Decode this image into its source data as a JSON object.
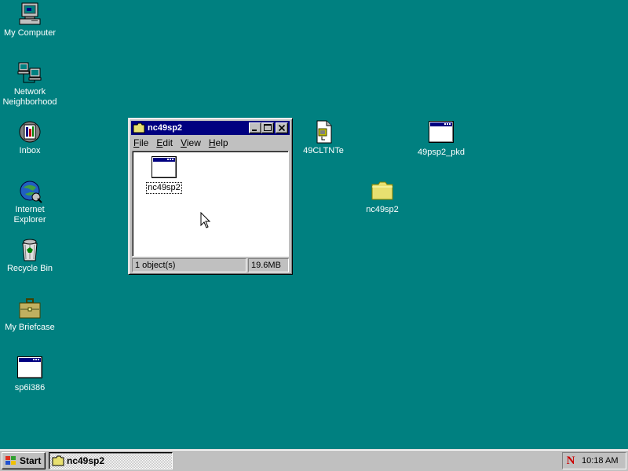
{
  "desktop": {
    "background": "#008080",
    "icons": [
      {
        "label": "My Computer",
        "icon": "my-computer-icon"
      },
      {
        "label": "Network",
        "label2": "Neighborhood",
        "icon": "network-neighborhood-icon"
      },
      {
        "label": "Inbox",
        "icon": "inbox-icon"
      },
      {
        "label": "Internet",
        "label2": "Explorer",
        "icon": "internet-explorer-icon"
      },
      {
        "label": "Recycle Bin",
        "icon": "recycle-bin-icon"
      },
      {
        "label": "My Briefcase",
        "icon": "briefcase-icon"
      },
      {
        "label": "sp6i386",
        "icon": "application-icon"
      },
      {
        "label": "49CLTNTe",
        "icon": "setup-document-icon"
      },
      {
        "label": "49psp2_pkd",
        "icon": "application-icon"
      },
      {
        "label": "nc49sp2",
        "icon": "folder-icon"
      }
    ]
  },
  "window": {
    "title": "nc49sp2",
    "menu": [
      {
        "label": "File",
        "accel": "F",
        "rest": "ile"
      },
      {
        "label": "Edit",
        "accel": "E",
        "rest": "dit"
      },
      {
        "label": "View",
        "accel": "V",
        "rest": "iew"
      },
      {
        "label": "Help",
        "accel": "H",
        "rest": "elp"
      }
    ],
    "items": [
      {
        "label": "nc49sp2",
        "icon": "application-icon"
      }
    ],
    "status": {
      "objects": "1 object(s)",
      "size": "19.6MB"
    }
  },
  "taskbar": {
    "start_label": "Start",
    "tasks": [
      {
        "label": "nc49sp2",
        "icon": "folder-icon"
      }
    ],
    "clock": "10:18 AM",
    "tray_icon": "netscape-icon"
  }
}
